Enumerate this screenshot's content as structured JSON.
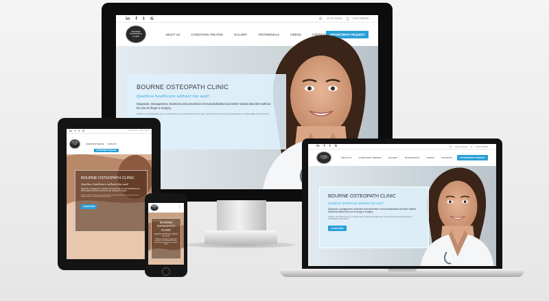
{
  "site": {
    "social_icons": [
      {
        "name": "linkedin-icon",
        "glyph": "in"
      },
      {
        "name": "facebook-icon",
        "glyph": "f"
      },
      {
        "name": "twitter-icon",
        "glyph": "t"
      },
      {
        "name": "google-icon",
        "glyph": "G"
      }
    ],
    "phone_1": "01776 222222",
    "phone_2": "07912 555255",
    "logo_lines": [
      "BOURNE",
      "OSTEOPATH",
      "CLINIC"
    ],
    "nav": [
      "ABOUT US",
      "CONDITIONS TREATED",
      "GALLERY",
      "TESTIMONIALS",
      "VIDEOS",
      "CONTACTS"
    ],
    "appointment_label": "APPOINTMENT REQUEST",
    "hero_title": "BOURNE OSTEOPATH CLINIC",
    "hero_tagline": "Qualitive healthcare without the wait!",
    "hero_description": "Diagnosis, management, treatment and prevention of musculoskeletal and other related disorders without the use of drugs or surgery.",
    "hero_small": "In Bourne, all treatments are in a medical centre, providing the perfect safe, caring environment, giving reassurance, confidentiality to the patients.",
    "learn_more": "LEARN MORE"
  },
  "colors": {
    "accent": "#2a9fd8",
    "device_frame": "#111111",
    "hero_panel": "#def0fc"
  }
}
